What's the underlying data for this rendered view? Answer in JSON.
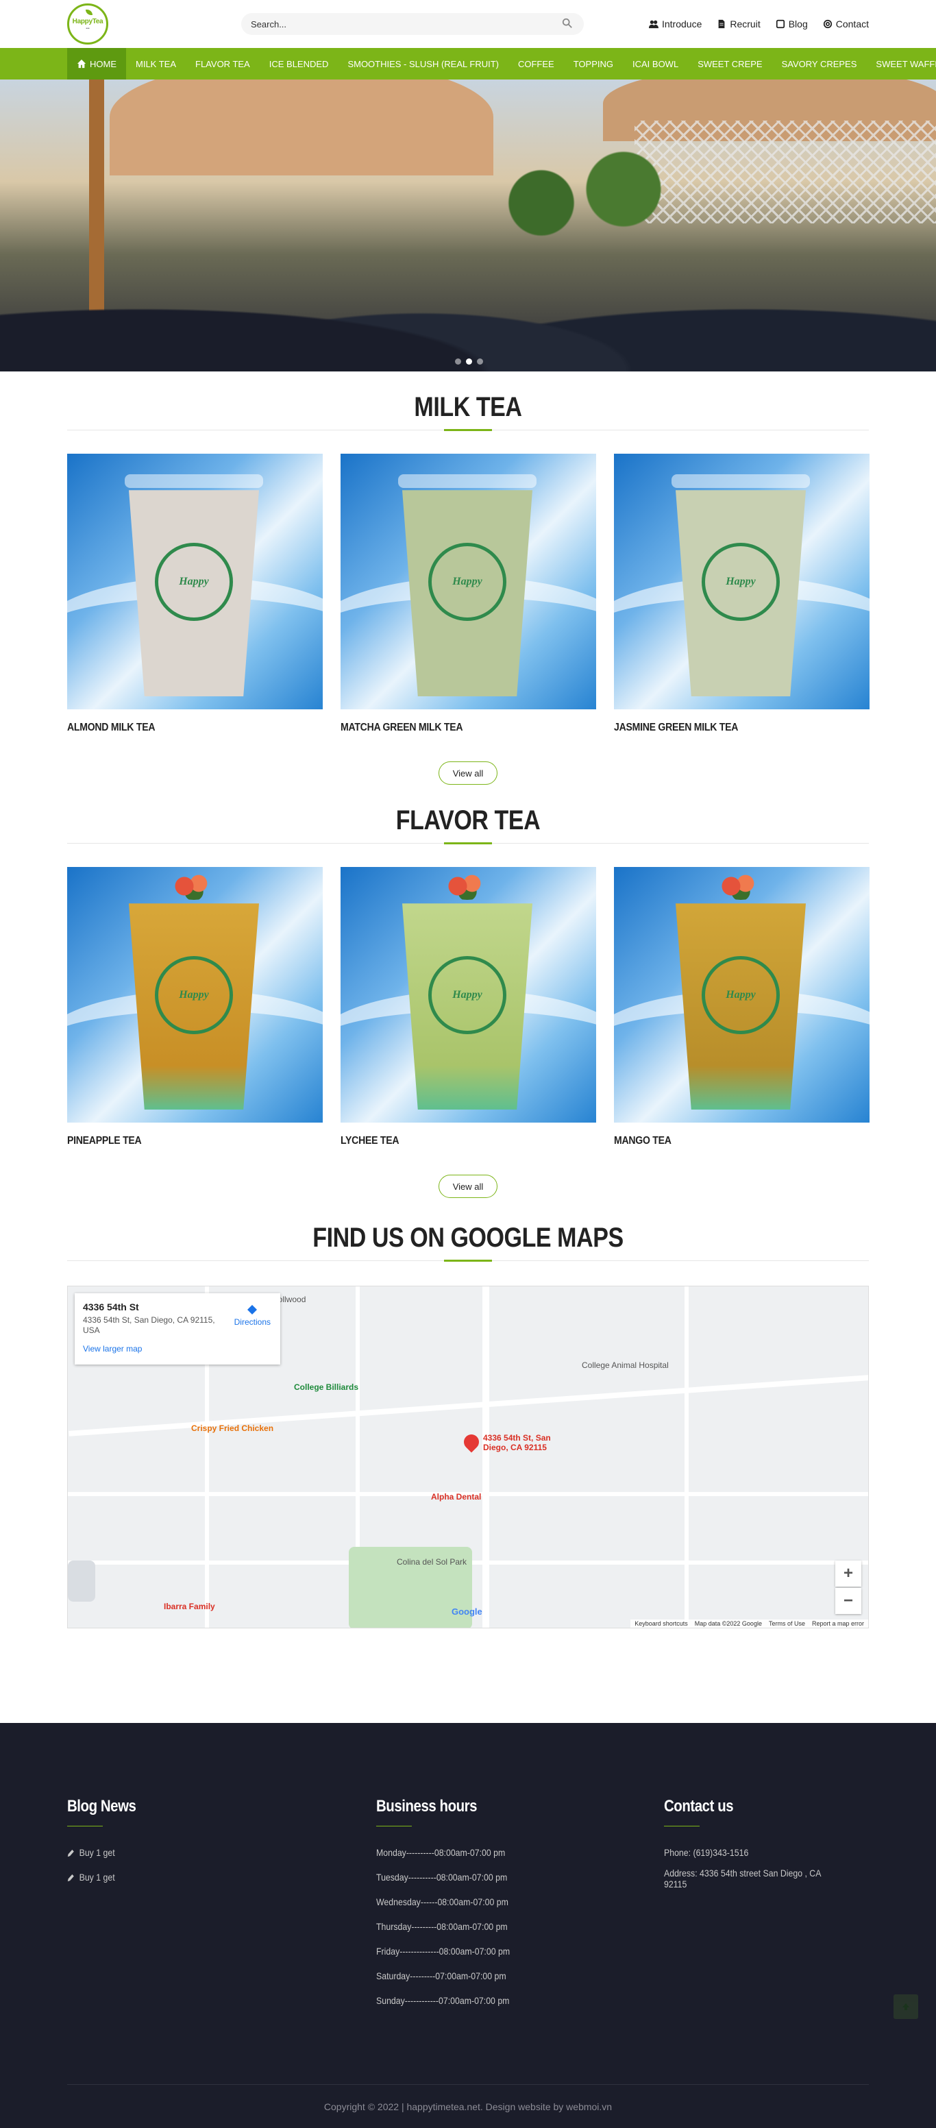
{
  "header": {
    "logo_text": "HappyTea",
    "search_placeholder": "Search...",
    "links": [
      {
        "icon": "users-icon",
        "label": "Introduce"
      },
      {
        "icon": "file-icon",
        "label": "Recruit"
      },
      {
        "icon": "square-icon",
        "label": "Blog"
      },
      {
        "icon": "at-icon",
        "label": "Contact"
      }
    ]
  },
  "nav": {
    "items": [
      "HOME",
      "MILK TEA",
      "FLAVOR TEA",
      "ICE BLENDED",
      "SMOOTHIES - SLUSH (REAL FRUIT)",
      "COFFEE",
      "TOPPING",
      "ICAI BOWL",
      "SWEET CREPE",
      "SAVORY CREPES",
      "SWEET WAFFLE"
    ],
    "accent": "#7cb518"
  },
  "milk_tea": {
    "title": "MILK TEA",
    "products": [
      {
        "name": "ALMOND MILK TEA",
        "cup_color": "#dcd6cf"
      },
      {
        "name": "MATCHA GREEN MILK TEA",
        "cup_color": "#b8c79a"
      },
      {
        "name": "JASMINE GREEN MILK TEA",
        "cup_color": "#c8d0b2"
      }
    ],
    "view_all": "View all"
  },
  "flavor_tea": {
    "title": "FLAVOR TEA",
    "products": [
      {
        "name": "PINEAPPLE TEA",
        "cup_color": "#d9a93b"
      },
      {
        "name": "LYCHEE TEA",
        "cup_color": "#b6cf84"
      },
      {
        "name": "MANGO TEA",
        "cup_color": "#c9a53b"
      }
    ],
    "view_all": "View all"
  },
  "maps": {
    "title": "FIND US ON GOOGLE MAPS",
    "info_title": "4336 54th St",
    "info_address": "4336 54th St, San Diego, CA 92115, USA",
    "larger_map": "View larger map",
    "directions": "Directions",
    "marker_label": "4336 54th St, San Diego, CA 92115",
    "map_footer": [
      "Keyboard shortcuts",
      "Map data ©2022 Google",
      "Terms of Use",
      "Report a map error"
    ],
    "google": "Google"
  },
  "footer": {
    "blog": {
      "title": "Blog News",
      "items": [
        "Buy 1 get",
        "Buy 1 get"
      ]
    },
    "hours": {
      "title": "Business hours",
      "items": [
        "Monday----------08:00am-07:00 pm",
        "Tuesday----------08:00am-07:00 pm",
        "Wednesday------08:00am-07:00 pm",
        "Thursday---------08:00am-07:00 pm",
        "Friday--------------08:00am-07:00 pm",
        "Saturday---------07:00am-07:00 pm",
        "Sunday------------07:00am-07:00 pm"
      ]
    },
    "contact": {
      "title": "Contact us",
      "items": [
        "Phone: (619)343-1516",
        "Address: 4336 54th street San Diego , CA 92115"
      ]
    },
    "copyright": "Copyright © 2022 | happytimetea.net. Design website by webmoi.vn"
  }
}
